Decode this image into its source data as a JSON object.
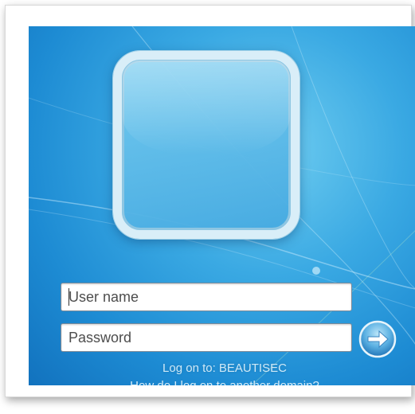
{
  "login": {
    "username_placeholder": "User name",
    "password_placeholder": "Password",
    "logon_to": "Log on to: BEAUTISEC",
    "domain_link": "How do I log on to another domain?",
    "submit_icon": "arrow-right-icon",
    "avatar_icon": "user-tile-icon"
  },
  "colors": {
    "background": "#1d8bd3",
    "tile_frame": "#d9eef8",
    "text": "#cfe9f7"
  }
}
